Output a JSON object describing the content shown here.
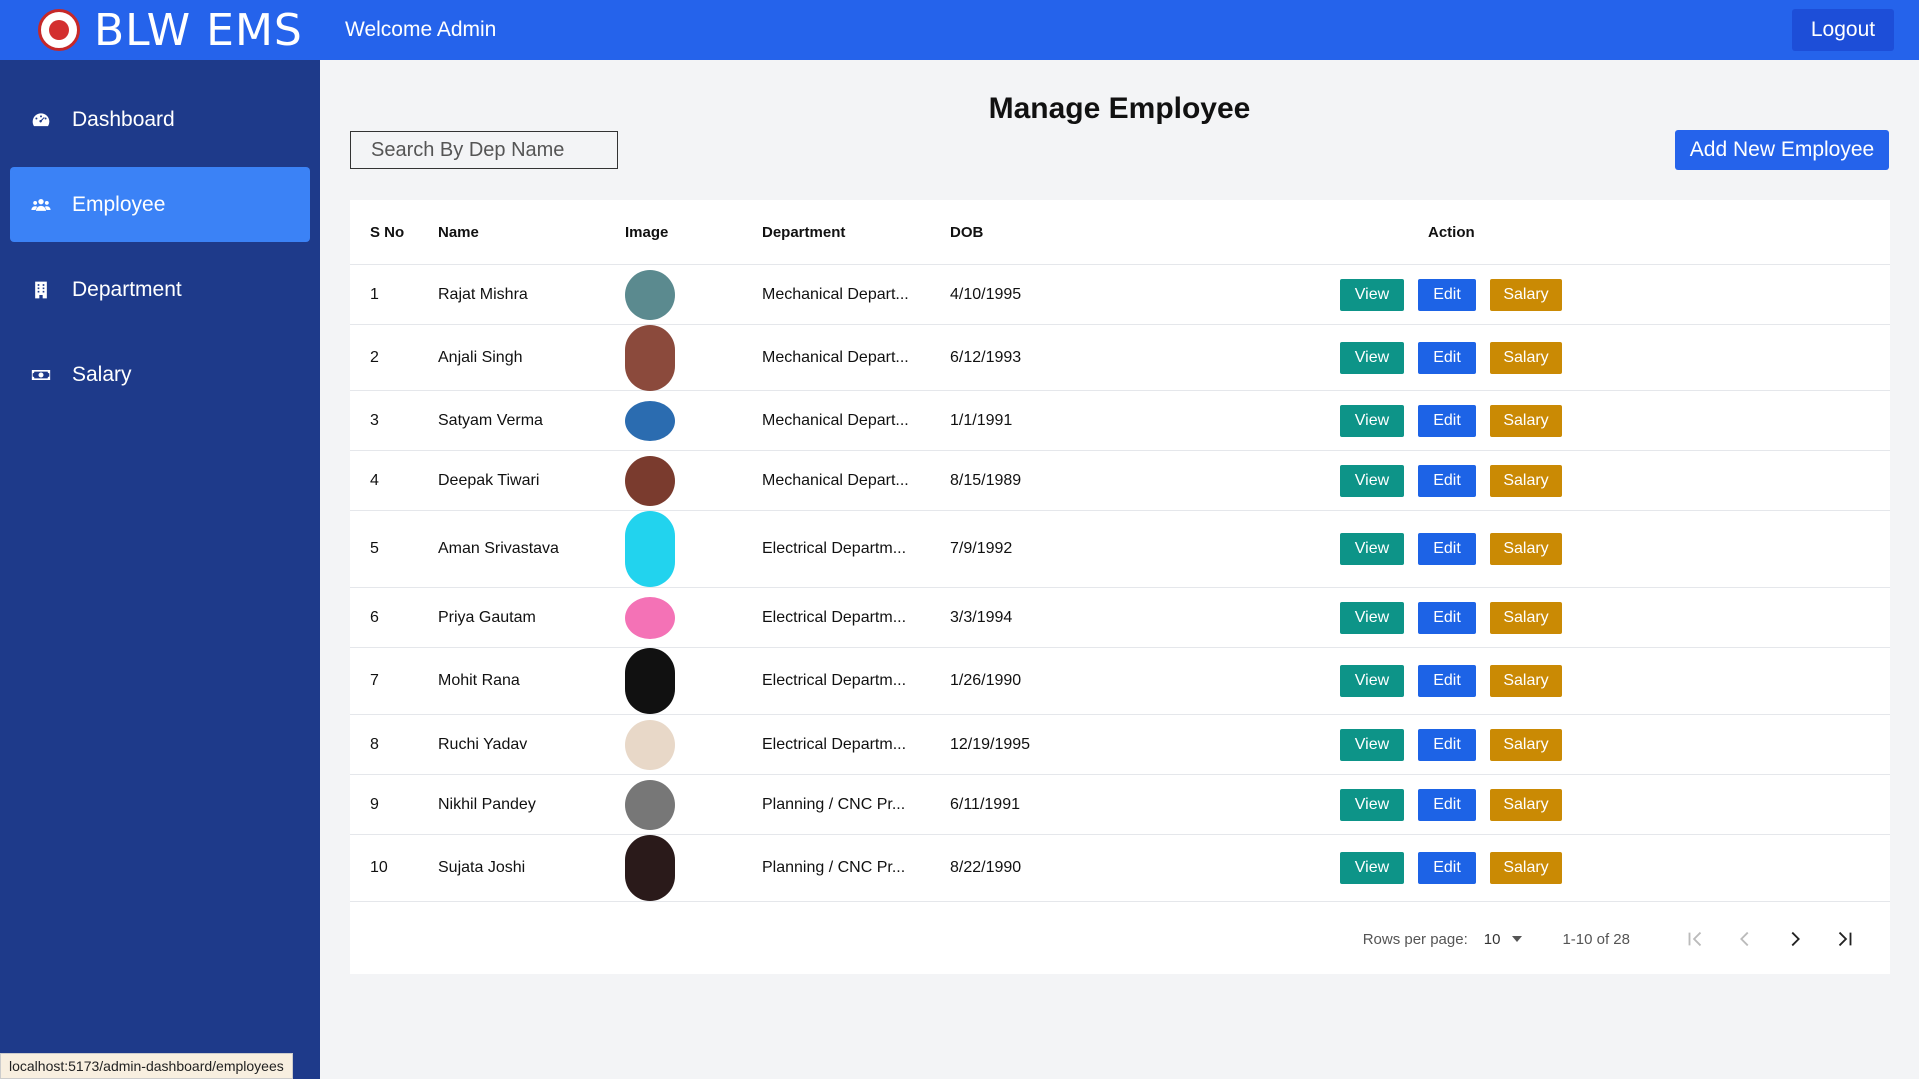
{
  "app": {
    "title": "BLW EMS"
  },
  "sidebar": {
    "items": [
      {
        "label": "Dashboard",
        "icon": "gauge-icon"
      },
      {
        "label": "Employee",
        "icon": "users-icon",
        "active": true
      },
      {
        "label": "Department",
        "icon": "building-icon"
      },
      {
        "label": "Salary",
        "icon": "money-icon"
      }
    ]
  },
  "topbar": {
    "welcome": "Welcome Admin",
    "logout_label": "Logout"
  },
  "main": {
    "title": "Manage Employee",
    "search_placeholder": "Search By Dep Name",
    "add_button_label": "Add New Employee"
  },
  "table": {
    "headers": {
      "sno": "S No",
      "name": "Name",
      "image": "Image",
      "department": "Department",
      "dob": "DOB",
      "action": "Action"
    },
    "action_labels": {
      "view": "View",
      "edit": "Edit",
      "salary": "Salary"
    },
    "rows": [
      {
        "sno": "1",
        "name": "Rajat Mishra",
        "department": "Mechanical Depart...",
        "dob": "4/10/1995",
        "avatar_color": "#5b8a8f"
      },
      {
        "sno": "2",
        "name": "Anjali Singh",
        "department": "Mechanical Depart...",
        "dob": "6/12/1993",
        "avatar_color": "#8b4a3c"
      },
      {
        "sno": "3",
        "name": "Satyam Verma",
        "department": "Mechanical Depart...",
        "dob": "1/1/1991",
        "avatar_color": "#2b6cb0"
      },
      {
        "sno": "4",
        "name": "Deepak Tiwari",
        "department": "Mechanical Depart...",
        "dob": "8/15/1989",
        "avatar_color": "#7a3b2e"
      },
      {
        "sno": "5",
        "name": "Aman Srivastava",
        "department": "Electrical Departm...",
        "dob": "7/9/1992",
        "avatar_color": "#22d3ee"
      },
      {
        "sno": "6",
        "name": "Priya Gautam",
        "department": "Electrical Departm...",
        "dob": "3/3/1994",
        "avatar_color": "#f472b6"
      },
      {
        "sno": "7",
        "name": "Mohit Rana",
        "department": "Electrical Departm...",
        "dob": "1/26/1990",
        "avatar_color": "#111111"
      },
      {
        "sno": "8",
        "name": "Ruchi Yadav",
        "department": "Electrical Departm...",
        "dob": "12/19/1995",
        "avatar_color": "#e8d8c8"
      },
      {
        "sno": "9",
        "name": "Nikhil Pandey",
        "department": "Planning / CNC Pr...",
        "dob": "6/11/1991",
        "avatar_color": "#777777"
      },
      {
        "sno": "10",
        "name": "Sujata Joshi",
        "department": "Planning / CNC Pr...",
        "dob": "8/22/1990",
        "avatar_color": "#2a1a1a"
      }
    ]
  },
  "pagination": {
    "rows_per_page_label": "Rows per page:",
    "rows_per_page_value": "10",
    "range": "1-10 of 28"
  },
  "status_bar": {
    "url": "localhost:5173/admin-dashboard/employees"
  },
  "colors": {
    "primary": "#2563eb",
    "sidebar": "#1e3a8a",
    "view": "#0d9488",
    "edit": "#1d63e6",
    "salary": "#ca8a04"
  }
}
